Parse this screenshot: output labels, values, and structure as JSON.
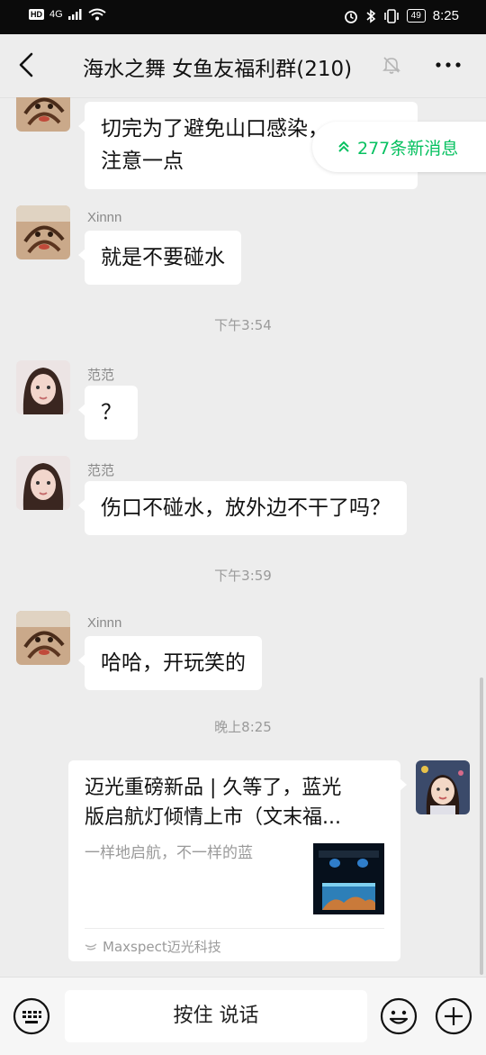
{
  "status_bar": {
    "network": "4G",
    "battery": "49",
    "time": "8:25"
  },
  "header": {
    "title": "海水之舞 女鱼友福利群(210)"
  },
  "new_messages": {
    "label": "277条新消息"
  },
  "messages": [
    {
      "sender": "",
      "text": "切完为了避免山口感染，注意一点"
    },
    {
      "sender": "Xinnn",
      "text": "就是不要碰水"
    },
    {
      "sender": "范范",
      "text": "？"
    },
    {
      "sender": "范范",
      "text": "伤口不碰水，放外边不干了吗？"
    },
    {
      "sender": "Xinnn",
      "text": "哈哈，开玩笑的"
    }
  ],
  "first_bubble_lines": [
    "切完为了避免山口感染，",
    "注意一点"
  ],
  "timestamps": [
    "下午3:54",
    "下午3:59",
    "晚上8:25"
  ],
  "card": {
    "title_lines": [
      "迈光重磅新品 | 久等了，蓝光",
      "版启航灯倾情上市（文末福..."
    ],
    "description": "一样地启航，不一样的蓝",
    "source": "Maxspect迈光科技"
  },
  "input_bar": {
    "voice_label": "按住 说话"
  },
  "icons": {
    "back": "chevron-left-icon",
    "mute": "muted-bell-icon",
    "more": "more-dots-icon",
    "keyboard": "keyboard-icon",
    "emoji": "emoji-icon",
    "plus": "plus-icon"
  },
  "colors": {
    "accent": "#07c160",
    "background": "#ededed",
    "bubble": "#ffffff"
  }
}
